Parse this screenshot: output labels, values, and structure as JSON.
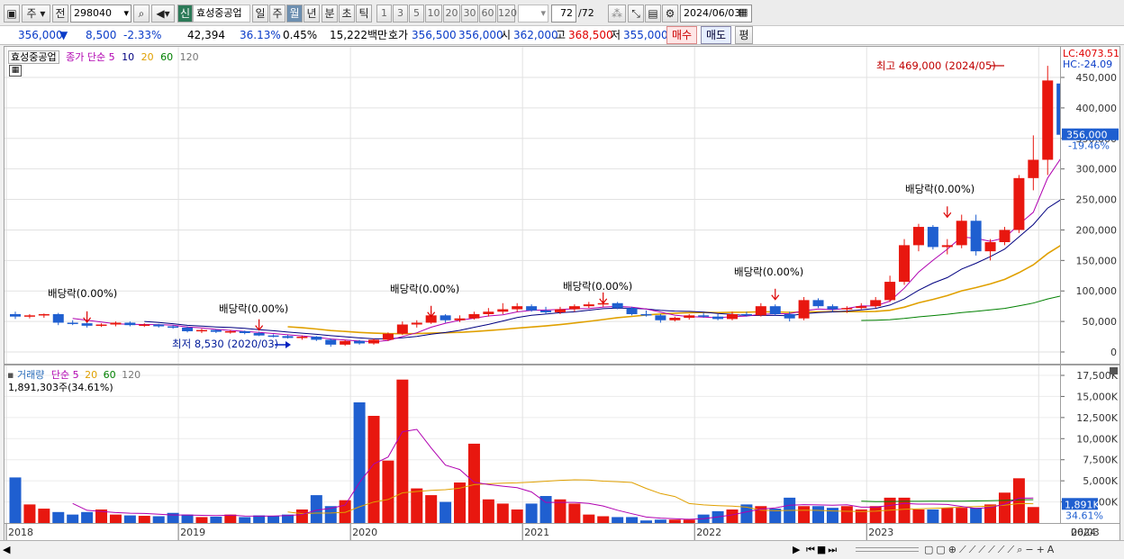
{
  "toolbar": {
    "period_type": "주",
    "prev_label": "전",
    "code": "298040",
    "company_badge": "신",
    "company_name": "효성중공업",
    "periods": [
      "일",
      "주",
      "월",
      "년",
      "분",
      "초",
      "틱"
    ],
    "active_period": "월",
    "intervals": [
      "1",
      "3",
      "5",
      "10",
      "20",
      "30",
      "60",
      "120"
    ],
    "count_current": "72",
    "count_total": "/72",
    "date": "2024/06/03"
  },
  "quote": {
    "price": "356,000",
    "change_symbol": "▼",
    "change": "8,500",
    "change_rate": "-2.33%",
    "volume": "42,394",
    "volume_rate": "36.13%",
    "turnover_rate": "0.45%",
    "amount": "15,222백만",
    "bid_label": "호가",
    "bid_ask": "356,500",
    "bid_bid": "356,000",
    "open_label": "시",
    "open": "362,000",
    "high_label": "고",
    "high": "368,500",
    "low_label": "저",
    "low": "355,000",
    "buy_label": "매수",
    "sell_label": "매도",
    "eval_label": "평"
  },
  "price_panel": {
    "name": "효성중공업",
    "ma_label": "종가 단순 5",
    "ma_periods": [
      "10",
      "20",
      "60",
      "120"
    ],
    "lc": "LC:4073.51",
    "hc": "HC:-24.09",
    "high_annotation": "최고 469,000 (2024/05)",
    "low_annotation": "최저 8,530 (2020/03)",
    "dividend_label": "배당락(0.00%)",
    "current_price_tag": "356,000",
    "current_rate_tag": "-19.46%",
    "y_ticks": [
      "450,000",
      "400,000",
      "350,000",
      "300,000",
      "250,000",
      "200,000",
      "150,000",
      "100,000",
      "50,000",
      "0"
    ]
  },
  "volume_panel": {
    "title": "거래량",
    "ma_label": "단순 5",
    "ma_periods": [
      "20",
      "60",
      "120"
    ],
    "current": "1,891,303주(34.61%)",
    "tag_value": "1,891K",
    "tag_rate": "34.61%",
    "y_ticks": [
      "17,500K",
      "15,000K",
      "12,500K",
      "10,000K",
      "7,500K",
      "5,000K",
      "2,500K"
    ]
  },
  "x_axis": [
    "2018",
    "2019",
    "2020",
    "2021",
    "2022",
    "2023",
    "2024",
    "06/03"
  ],
  "colors": {
    "up": "#e8170f",
    "down": "#1f5fd0",
    "ma5": "#b000b0",
    "ma10": "#000080",
    "ma20": "#e0a000",
    "ma60": "#008000",
    "ma120": "#777777"
  },
  "chart_data": {
    "type": "candlestick",
    "title": "효성중공업",
    "x": [
      "2018",
      "2019",
      "2020",
      "2021",
      "2022",
      "2023",
      "2024"
    ],
    "ylim": [
      0,
      490000
    ],
    "candles": [
      [
        62000,
        66000,
        54000,
        58000
      ],
      [
        58000,
        62000,
        55000,
        60000
      ],
      [
        60000,
        63000,
        56000,
        62000
      ],
      [
        62000,
        64000,
        44000,
        48000
      ],
      [
        48000,
        52000,
        44000,
        47000
      ],
      [
        47000,
        50000,
        40000,
        43000
      ],
      [
        43000,
        47000,
        41000,
        45000
      ],
      [
        45000,
        50000,
        42000,
        48000
      ],
      [
        48000,
        50000,
        42000,
        44000
      ],
      [
        44000,
        47000,
        41000,
        45000
      ],
      [
        45000,
        46000,
        40000,
        42000
      ],
      [
        42000,
        44000,
        38000,
        40000
      ],
      [
        40000,
        42000,
        32000,
        34000
      ],
      [
        34000,
        38000,
        31000,
        36000
      ],
      [
        36000,
        37000,
        31000,
        33000
      ],
      [
        33000,
        36000,
        30000,
        34000
      ],
      [
        34000,
        35000,
        29000,
        31000
      ],
      [
        31000,
        33000,
        26000,
        27000
      ],
      [
        27000,
        29000,
        24000,
        26000
      ],
      [
        26000,
        28000,
        22000,
        23000
      ],
      [
        23000,
        27000,
        20000,
        25000
      ],
      [
        25000,
        26000,
        18000,
        20000
      ],
      [
        20000,
        22000,
        8530,
        12000
      ],
      [
        12000,
        20000,
        10000,
        18000
      ],
      [
        18000,
        20000,
        12000,
        14000
      ],
      [
        14000,
        22000,
        12000,
        20000
      ],
      [
        20000,
        32000,
        18000,
        30000
      ],
      [
        30000,
        50000,
        28000,
        45000
      ],
      [
        45000,
        52000,
        40000,
        48000
      ],
      [
        48000,
        68000,
        46000,
        60000
      ],
      [
        60000,
        62000,
        48000,
        52000
      ],
      [
        52000,
        60000,
        49000,
        55000
      ],
      [
        55000,
        66000,
        53000,
        62000
      ],
      [
        62000,
        72000,
        58000,
        66000
      ],
      [
        66000,
        80000,
        62000,
        70000
      ],
      [
        70000,
        80000,
        66000,
        75000
      ],
      [
        75000,
        78000,
        66000,
        68000
      ],
      [
        68000,
        74000,
        62000,
        65000
      ],
      [
        65000,
        74000,
        62000,
        70000
      ],
      [
        70000,
        78000,
        66000,
        75000
      ],
      [
        75000,
        82000,
        72000,
        78000
      ],
      [
        78000,
        84000,
        74000,
        80000
      ],
      [
        80000,
        82000,
        70000,
        72000
      ],
      [
        72000,
        74000,
        60000,
        62000
      ],
      [
        62000,
        68000,
        58000,
        60000
      ],
      [
        60000,
        62000,
        48000,
        52000
      ],
      [
        52000,
        58000,
        50000,
        56000
      ],
      [
        56000,
        62000,
        53000,
        60000
      ],
      [
        60000,
        64000,
        56000,
        58000
      ],
      [
        58000,
        62000,
        52000,
        54000
      ],
      [
        54000,
        66000,
        52000,
        62000
      ],
      [
        62000,
        66000,
        58000,
        60000
      ],
      [
        60000,
        80000,
        58000,
        75000
      ],
      [
        75000,
        78000,
        60000,
        62000
      ],
      [
        62000,
        66000,
        50000,
        55000
      ],
      [
        55000,
        90000,
        52000,
        85000
      ],
      [
        85000,
        88000,
        72000,
        75000
      ],
      [
        75000,
        78000,
        66000,
        70000
      ],
      [
        70000,
        75000,
        64000,
        72000
      ],
      [
        72000,
        80000,
        70000,
        75000
      ],
      [
        75000,
        90000,
        72000,
        85000
      ],
      [
        85000,
        125000,
        82000,
        115000
      ],
      [
        115000,
        185000,
        110000,
        175000
      ],
      [
        175000,
        210000,
        165000,
        205000
      ],
      [
        205000,
        208000,
        168000,
        172000
      ],
      [
        172000,
        185000,
        160000,
        175000
      ],
      [
        175000,
        225000,
        170000,
        215000
      ],
      [
        215000,
        225000,
        158000,
        165000
      ],
      [
        165000,
        185000,
        150000,
        180000
      ],
      [
        180000,
        205000,
        175000,
        200000
      ],
      [
        200000,
        290000,
        195000,
        285000
      ],
      [
        285000,
        355000,
        265000,
        315000
      ],
      [
        315000,
        469000,
        290000,
        445000
      ],
      [
        440000,
        445000,
        350000,
        356000
      ]
    ],
    "volume_k": [
      5400,
      2200,
      1700,
      1300,
      1000,
      1300,
      1600,
      1000,
      900,
      850,
      800,
      1200,
      1000,
      700,
      750,
      1000,
      700,
      900,
      800,
      1000,
      1600,
      3300,
      2000,
      2700,
      14300,
      12700,
      7400,
      17000,
      4100,
      3300,
      2500,
      4800,
      9400,
      2800,
      2300,
      1600,
      2300,
      3200,
      2800,
      2300,
      1000,
      800,
      700,
      700,
      300,
      400,
      400,
      400,
      1000,
      1400,
      1600,
      2200,
      2000,
      1700,
      3000,
      2000,
      2000,
      1800,
      2000,
      1600,
      2000,
      3000,
      3000,
      1600,
      1600,
      1800,
      1800,
      1800,
      2200,
      3600,
      5300,
      1891
    ]
  }
}
